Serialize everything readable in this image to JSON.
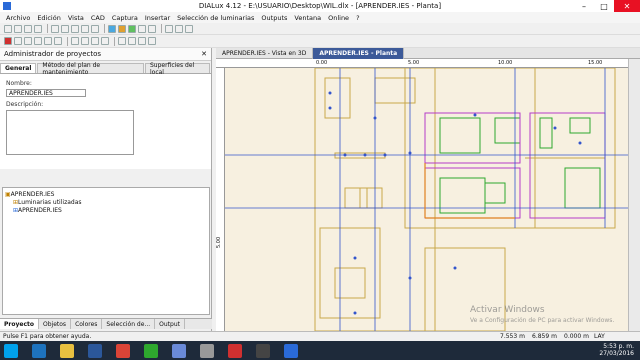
{
  "window": {
    "title": "DIALux 4.12 - E:\\USUARIO\\Desktop\\WIL.dlx - [APRENDER.IES - Planta]"
  },
  "menu": [
    "Archivo",
    "Edición",
    "Vista",
    "CAD",
    "Captura",
    "Insertar",
    "Selección de luminarias",
    "Outputs",
    "Ventana",
    "Online",
    "?"
  ],
  "left_panel": {
    "title": "Administrador de proyectos",
    "tabs": [
      "General",
      "Método del plan de mantenimiento",
      "Superficies del local"
    ],
    "name_label": "Nombre:",
    "name_value": "APRENDER.IES",
    "desc_label": "Descripción:",
    "tree": [
      "APRENDER.IES",
      "Luminarias utilizadas",
      "APRENDER.IES"
    ],
    "bottom_tabs": [
      "Proyecto",
      "Objetos",
      "Colores",
      "Selección de...",
      "Output"
    ]
  },
  "doc_tabs": [
    "APRENDER.IES - Vista en 3D",
    "APRENDER.IES - Planta"
  ],
  "ruler": {
    "h": [
      "0.00",
      "5.00",
      "10.00",
      "15.00"
    ],
    "v": [
      "5.00"
    ]
  },
  "status": {
    "help": "Pulse F1 para obtener ayuda.",
    "x": "7.553 m",
    "y": "6.859 m",
    "z": "0.000 m",
    "zoom": "LAY"
  },
  "watermark": {
    "line1": "Activar Windows",
    "line2": "Ve a Configuración de PC para activar Windows."
  },
  "clock": {
    "time": "5:53 p. m.",
    "date": "27/03/2016"
  },
  "colors": {
    "accent": "#3c5a99",
    "canvas": "#f7f0e0",
    "walls": "#c8a84a",
    "blue_lines": "#3355cc",
    "green": "#2ea82e",
    "magenta": "#b43cc8"
  }
}
